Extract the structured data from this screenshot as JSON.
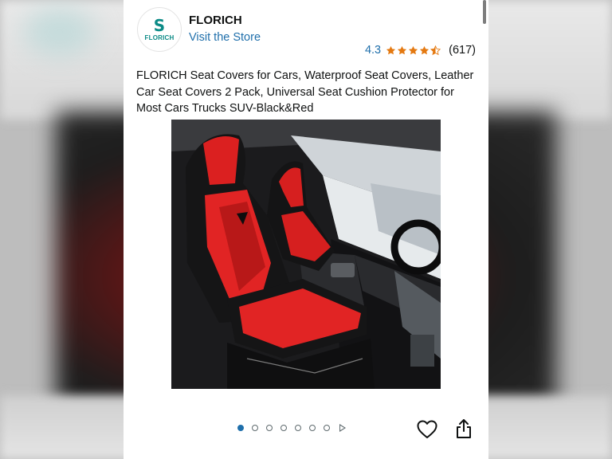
{
  "store": {
    "logo_text": "FLORICH",
    "logo_mark": "S",
    "name": "FLORICH",
    "visit_label": "Visit the Store"
  },
  "rating": {
    "value": "4.3",
    "stars": 4.3,
    "count": "(617)",
    "star_color": "#e47911"
  },
  "product": {
    "title": "FLORICH Seat Covers for Cars, Waterproof Seat Covers, Leather Car Seat Covers 2 Pack, Universal Seat Cushion Protector for Most Cars Trucks SUV-Black&Red",
    "image_alt": "Red and black leather seat covers installed on front car seats"
  },
  "carousel": {
    "total_dots": 7,
    "active_index": 0,
    "video_indicator": "play-icon"
  },
  "actions": {
    "wishlist_icon": "heart-icon",
    "share_icon": "share-icon"
  },
  "colors": {
    "link": "#1f6fab",
    "accent": "#0b8a86"
  }
}
